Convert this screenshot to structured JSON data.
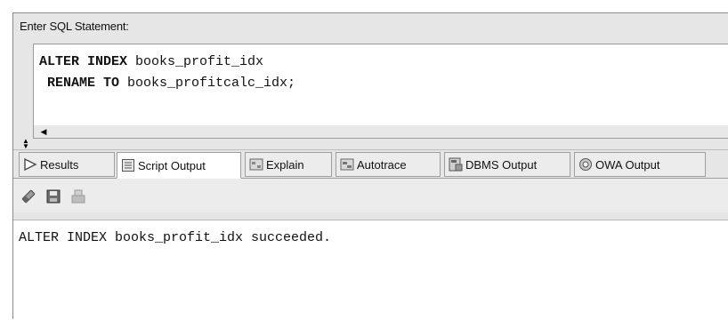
{
  "editor": {
    "label": "Enter SQL Statement:",
    "line1_kw": "ALTER INDEX",
    "line1_rest": " books_profit_idx",
    "line2_kw": " RENAME TO",
    "line2_rest": " books_profitcalc_idx;"
  },
  "tabs": [
    {
      "label": "Results",
      "icon": "results-arrow-icon"
    },
    {
      "label": "Script Output",
      "icon": "script-output-icon"
    },
    {
      "label": "Explain",
      "icon": "explain-plan-icon"
    },
    {
      "label": "Autotrace",
      "icon": "autotrace-icon"
    },
    {
      "label": "DBMS Output",
      "icon": "dbms-output-icon"
    },
    {
      "label": "OWA Output",
      "icon": "owa-output-icon"
    }
  ],
  "active_tab": "Script Output",
  "toolbar": [
    "eraser-icon",
    "save-icon",
    "print-icon"
  ],
  "output": {
    "text": "ALTER INDEX books_profit_idx succeeded."
  }
}
